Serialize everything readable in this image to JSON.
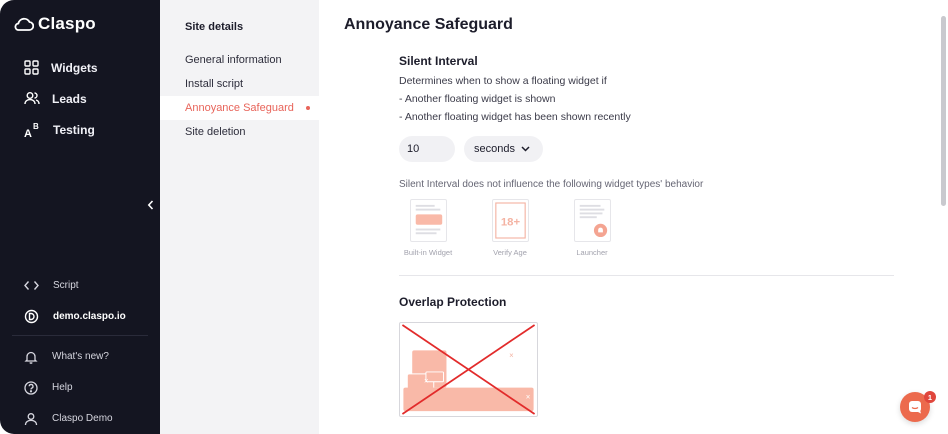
{
  "app": {
    "name": "Claspo"
  },
  "sidebar": {
    "nav": [
      {
        "label": "Widgets",
        "icon": "grid-icon"
      },
      {
        "label": "Leads",
        "icon": "users-icon"
      },
      {
        "label": "Testing",
        "icon": "ab-test-icon"
      }
    ],
    "bottom": [
      {
        "label": "Script",
        "icon": "code-icon"
      },
      {
        "label": "demo.claspo.io",
        "icon": "site-logo-icon"
      },
      {
        "label": "What's new?",
        "icon": "bell-icon"
      },
      {
        "label": "Help",
        "icon": "help-icon"
      },
      {
        "label": "Claspo Demo",
        "icon": "user-icon"
      }
    ]
  },
  "submenu": {
    "title": "Site details",
    "items": [
      {
        "label": "General information"
      },
      {
        "label": "Install script"
      },
      {
        "label": "Annoyance Safeguard"
      },
      {
        "label": "Site deletion"
      }
    ]
  },
  "main": {
    "title": "Annoyance Safeguard",
    "silent": {
      "heading": "Silent Interval",
      "description": [
        "Determines when to show a floating widget if",
        "- Another floating widget is shown",
        "- Another floating widget has been shown recently"
      ],
      "value": "10",
      "unit": "seconds",
      "note": "Silent Interval does not influence the following widget types' behavior",
      "types": [
        {
          "label": "Built-in Widget",
          "icon": "built-in-widget-icon"
        },
        {
          "label": "Verify Age",
          "icon": "verify-age-icon"
        },
        {
          "label": "Launcher",
          "icon": "launcher-icon"
        }
      ]
    },
    "overlap": {
      "heading": "Overlap Protection"
    }
  },
  "chat": {
    "badge": "1"
  },
  "colors": {
    "accent": "#e8645a",
    "sidebar_bg": "#141521",
    "submenu_bg": "#f3f3f5",
    "chat": "#ec6a4d"
  }
}
